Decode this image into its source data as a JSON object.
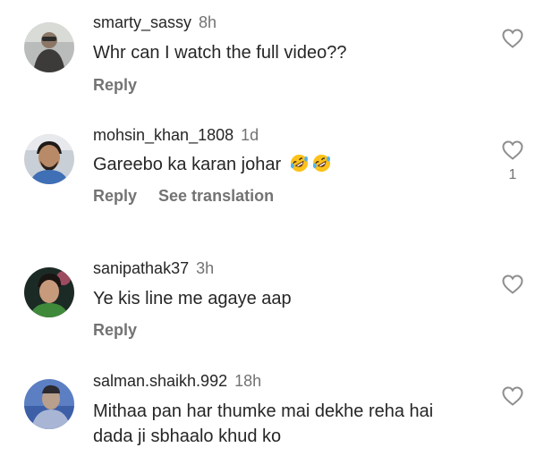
{
  "comments": [
    {
      "username": "smarty_sassy",
      "time": "8h",
      "text": "Whr can I watch the full video??",
      "reply": "Reply"
    },
    {
      "username": "mohsin_khan_1808",
      "time": "1d",
      "text": "Gareebo ka karan johar",
      "emoji_icons": [
        "rolling-on-floor-laughing-emoji",
        "rolling-on-floor-laughing-emoji"
      ],
      "reply": "Reply",
      "see_translation": "See translation",
      "likes": "1"
    },
    {
      "username": "sanipathak37",
      "time": "3h",
      "text": "Ye kis line me agaye aap",
      "reply": "Reply"
    },
    {
      "username": "salman.shaikh.992",
      "time": "18h",
      "text_line1": "Mithaa pan har thumke mai dekhe reha hai",
      "text_line2": "dada ji sbhaalo khud ko"
    }
  ],
  "icons": {
    "like": "heart-outline-icon"
  },
  "colors": {
    "text_primary": "#262626",
    "text_secondary": "#737373",
    "background": "#ffffff"
  }
}
